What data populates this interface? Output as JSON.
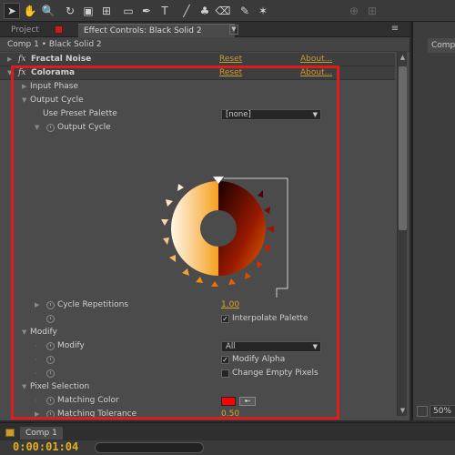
{
  "toolbar": {
    "tools": [
      {
        "icon": "selection-arrow-icon",
        "glyph": "➤",
        "active": true
      },
      {
        "icon": "hand-icon",
        "glyph": "✋"
      },
      {
        "icon": "zoom-icon",
        "glyph": "🔍"
      },
      {
        "icon": "rotate-icon",
        "glyph": "↻"
      },
      {
        "icon": "camera-icon",
        "glyph": "▣"
      },
      {
        "icon": "pan-behind-icon",
        "glyph": "⊞"
      },
      {
        "icon": "rectangle-mask-icon",
        "glyph": "▭"
      },
      {
        "icon": "pen-icon",
        "glyph": "✒"
      },
      {
        "icon": "text-icon",
        "glyph": "T"
      },
      {
        "icon": "brush-icon",
        "glyph": "╱"
      },
      {
        "icon": "clone-stamp-icon",
        "glyph": "♣"
      },
      {
        "icon": "eraser-icon",
        "glyph": "⌫"
      },
      {
        "icon": "roto-brush-icon",
        "glyph": "✎"
      },
      {
        "icon": "puppet-pin-icon",
        "glyph": "✶"
      },
      {
        "icon": "axis-icon",
        "glyph": "⊕",
        "dim": true
      },
      {
        "icon": "grid-icon",
        "glyph": "⊞",
        "dim": true
      }
    ]
  },
  "tabs": {
    "project": "Project",
    "effect_controls": "Effect Controls: Black Solid 2",
    "close": "×",
    "menu": "≡"
  },
  "breadcrumb": "Comp 1 • Black Solid 2",
  "effects": {
    "fractal_noise": {
      "name": "Fractal Noise",
      "reset": "Reset",
      "about": "About..."
    },
    "colorama": {
      "name": "Colorama",
      "reset": "Reset",
      "about": "About..."
    }
  },
  "rows": {
    "input_phase": "Input Phase",
    "output_cycle": "Output Cycle",
    "use_preset_palette": "Use Preset Palette",
    "preset_value": "[none]",
    "output_cycle_sub": "Output Cycle",
    "cycle_repetitions": "Cycle Repetitions",
    "cycle_repetitions_value": "1.00",
    "interpolate_palette": "Interpolate Palette",
    "modify": "Modify",
    "modify_sub": "Modify",
    "modify_value": "All",
    "modify_alpha": "Modify Alpha",
    "change_empty_pixels": "Change Empty Pixels",
    "pixel_selection": "Pixel Selection",
    "matching_color": "Matching Color",
    "matching_tolerance": "Matching Tolerance",
    "matching_tolerance_value": "0.50"
  },
  "checkboxes": {
    "interpolate_palette": true,
    "modify_alpha": true,
    "change_empty_pixels": false
  },
  "colors": {
    "accent_link": "#c99b2f",
    "value": "#d9a620",
    "matching_color": "#ff0000",
    "highlight_box": "#e01b1b"
  },
  "right_panel": {
    "tab": "Comp",
    "zoom": "50%"
  },
  "timeline": {
    "tab": "Comp 1",
    "timecode": "0:00:01:04"
  }
}
